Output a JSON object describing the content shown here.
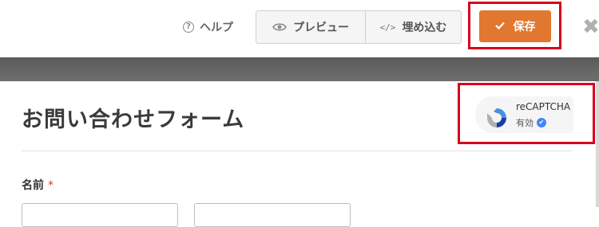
{
  "toolbar": {
    "help_label": "ヘルプ",
    "preview_label": "プレビュー",
    "embed_label": "埋め込む",
    "embed_icon_glyph": "</>",
    "save_label": "保存",
    "close_icon": "close-icon"
  },
  "form": {
    "title": "お問い合わせフォーム",
    "recaptcha": {
      "name": "reCAPTCHA",
      "status": "有効"
    },
    "fields": [
      {
        "label": "名前",
        "required_mark": "*"
      }
    ]
  },
  "colors": {
    "save_button": "#e27730",
    "highlight_border": "#d6001c",
    "required": "#d63638",
    "verified": "#4285f4"
  }
}
